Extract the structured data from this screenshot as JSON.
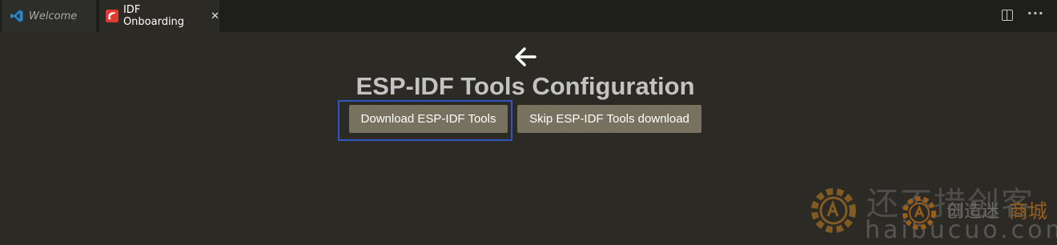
{
  "tabs": [
    {
      "label": "Welcome",
      "icon": "vscode-logo-icon",
      "active": false
    },
    {
      "label": "IDF Onboarding",
      "icon": "espressif-icon",
      "active": true,
      "close": "✕"
    }
  ],
  "toolbar": {
    "actions": [
      "split-editor-icon",
      "more-actions-icon"
    ]
  },
  "page": {
    "title": "ESP-IDF Tools Configuration",
    "back_icon": "back-arrow-icon"
  },
  "buttons": {
    "download_label": "Download ESP-IDF Tools",
    "skip_label": "Skip ESP-IDF Tools download"
  },
  "watermark": {
    "big_text": "还不措创客",
    "domain_text": "haibucuo.com",
    "brand_text": "创造迷",
    "mall_text": "商城"
  },
  "colors": {
    "background": "#2b2a25",
    "button": "#77725f",
    "highlight": "#3054c0",
    "watermark_accent": "#f08a18"
  }
}
